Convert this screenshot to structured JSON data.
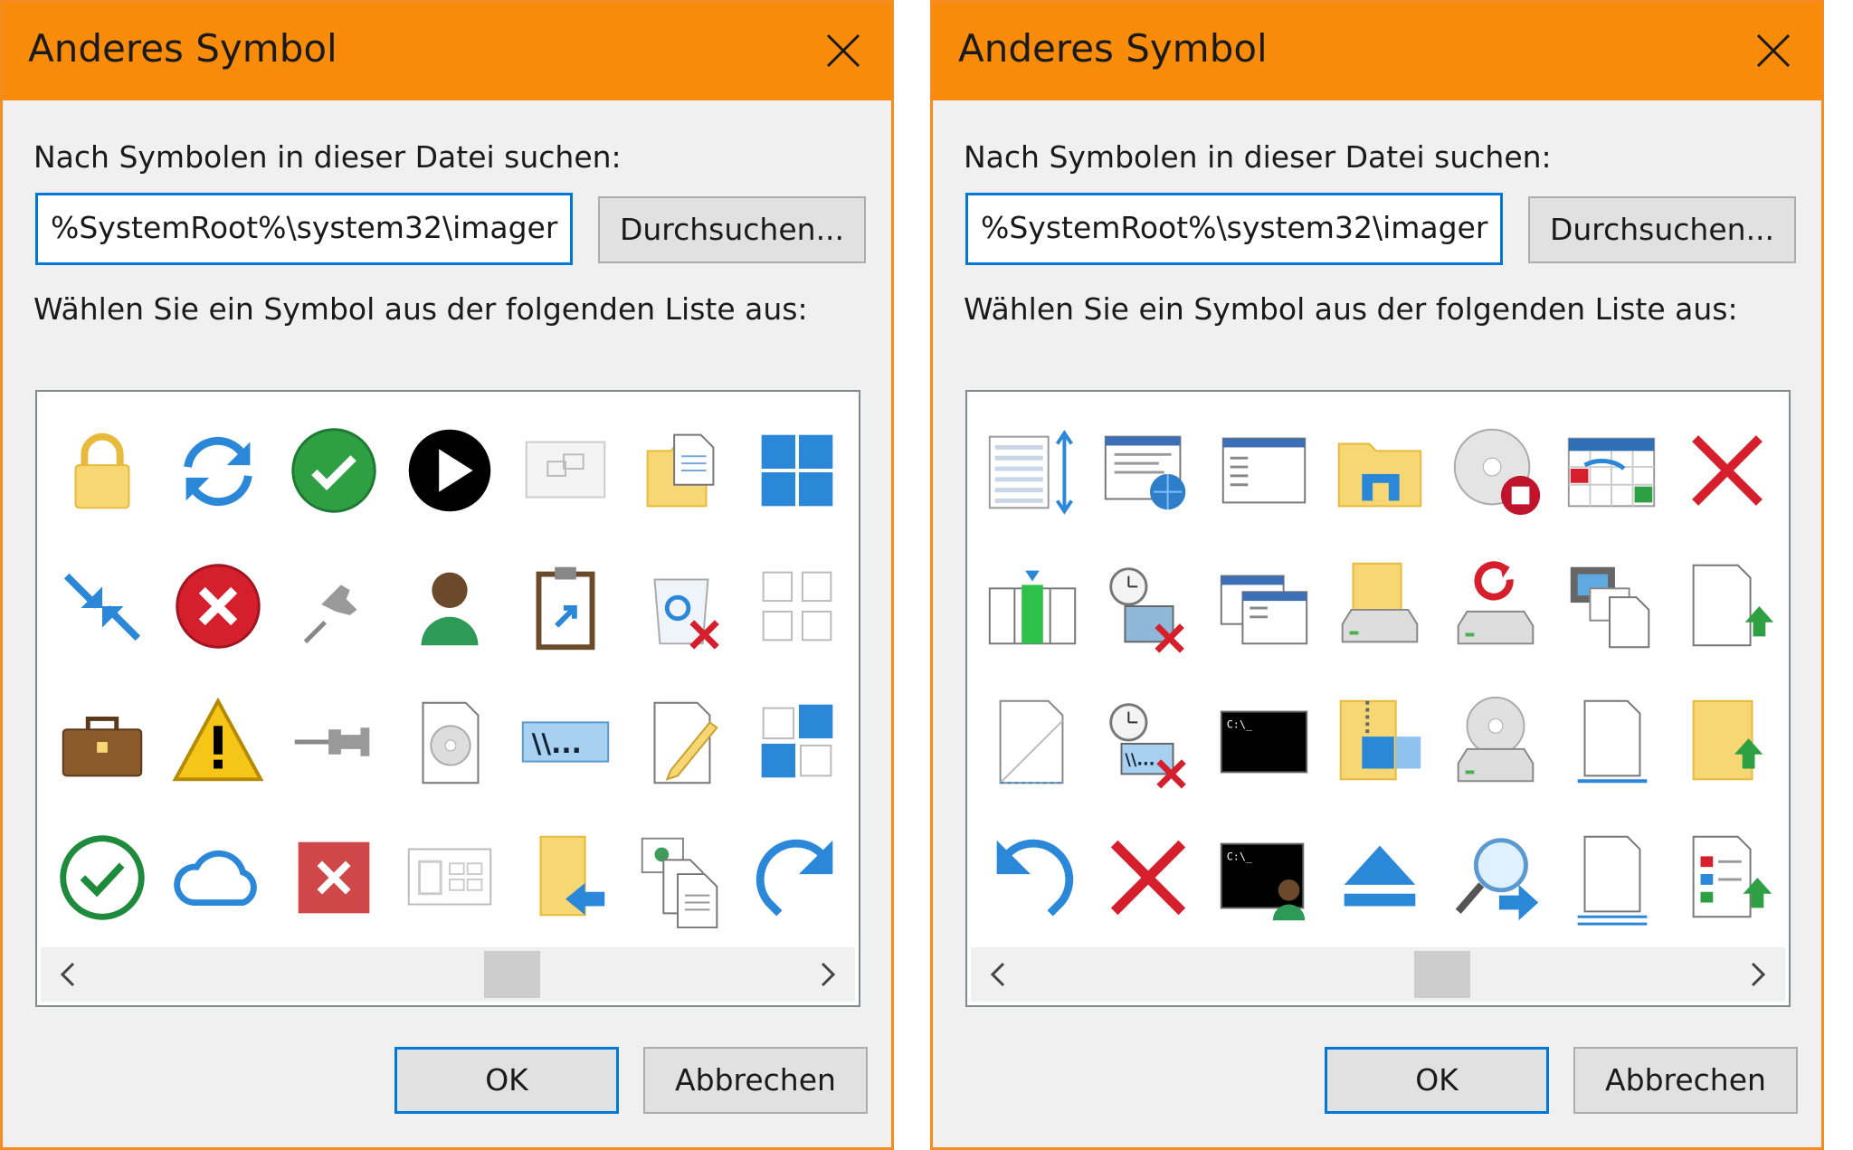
{
  "colors": {
    "titlebar": "#f98b0a",
    "accent": "#0078d7",
    "dialog_bg": "#f0f0f0"
  },
  "dialogs": [
    {
      "title": "Anderes Symbol",
      "search_label": "Nach Symbolen in dieser Datei suchen:",
      "path_value": "%SystemRoot%\\system32\\imager",
      "browse_label": "Durchsuchen...",
      "list_label": "Wählen Sie ein Symbol aus der folgenden Liste aus:",
      "ok_label": "OK",
      "cancel_label": "Abbrechen",
      "icons": [
        "padlock-icon",
        "sync-arrows-icon",
        "green-check-circle-icon",
        "play-circle-icon",
        "slideshow-frame-icon",
        "folder-documents-icon",
        "tiles-grid-icon",
        "shrink-arrows-icon",
        "red-error-icon",
        "pin-tilted-icon",
        "user-avatar-icon",
        "clipboard-shortcut-icon",
        "recycle-bin-delete-icon",
        "empty-grid-icon",
        "briefcase-icon",
        "warning-triangle-icon",
        "pin-side-icon",
        "cd-document-icon",
        "network-path-icon",
        "document-pencil-icon",
        "tiles-mixed-icon",
        "check-outline-icon",
        "cloud-icon",
        "red-x-square-icon",
        "dashed-window-icon",
        "folder-back-arrow-icon",
        "photo-documents-icon",
        "redo-arrow-icon"
      ]
    },
    {
      "title": "Anderes Symbol",
      "search_label": "Nach Symbolen in dieser Datei suchen:",
      "path_value": "%SystemRoot%\\system32\\imager",
      "browse_label": "Durchsuchen...",
      "list_label": "Wählen Sie ein Symbol aus der folgenden Liste aus:",
      "ok_label": "OK",
      "cancel_label": "Abbrechen",
      "icons": [
        "list-resize-icon",
        "web-page-globe-icon",
        "window-list-icon",
        "explorer-folder-icon",
        "disc-stop-icon",
        "calendar-move-icon",
        "red-x-icon",
        "column-insert-icon",
        "clock-photo-delete-icon",
        "windows-stack-icon",
        "folder-drive-icon",
        "drive-refresh-icon",
        "film-photo-icon",
        "document-upload-icon",
        "blank-document-dashed-icon",
        "clock-network-delete-icon",
        "command-prompt-icon",
        "zip-folder-icon",
        "cd-drive-icon",
        "document-tray-icon",
        "folder-upload-icon",
        "undo-arrow-icon",
        "red-x-large-icon",
        "command-prompt-user-icon",
        "eject-icon",
        "search-arrow-icon",
        "document-lines-icon",
        "list-upload-icon"
      ]
    }
  ]
}
